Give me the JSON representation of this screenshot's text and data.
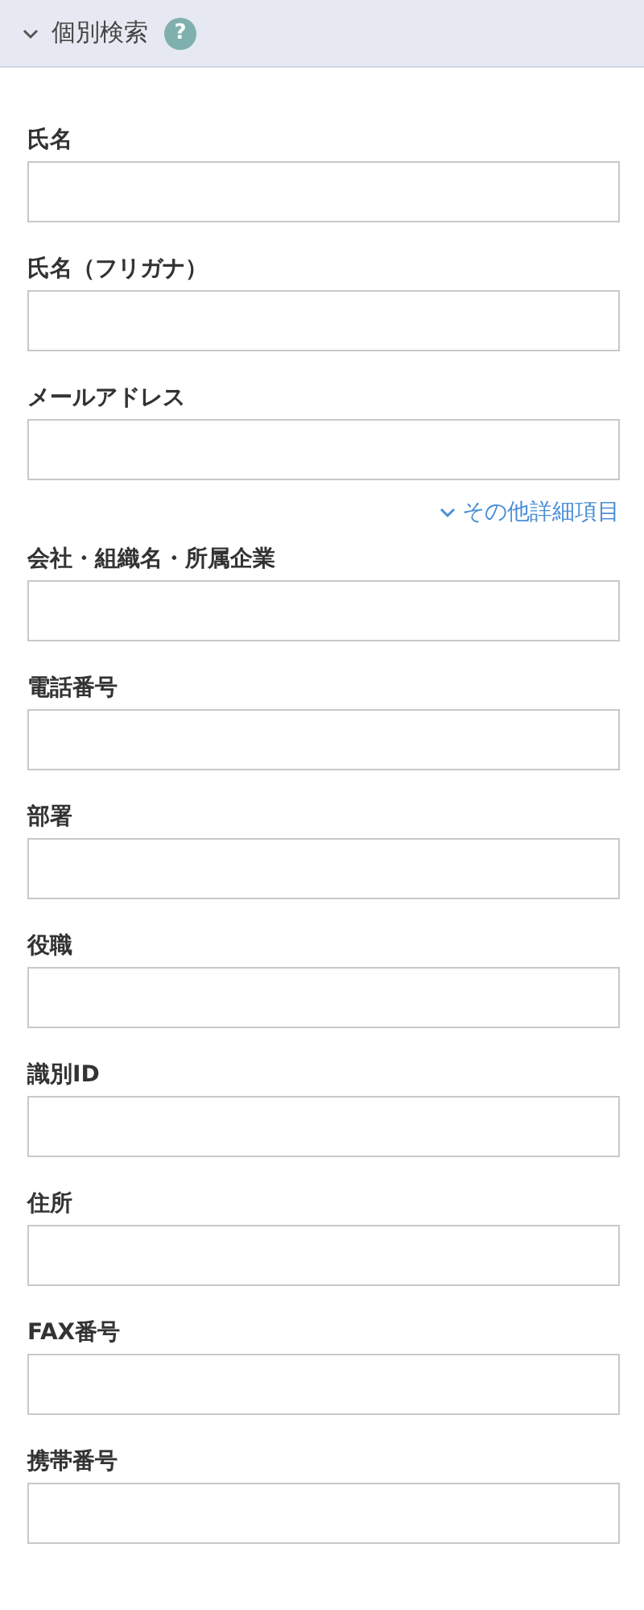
{
  "header": {
    "title": "個別検索",
    "help": "?",
    "expanded": true
  },
  "fields": [
    {
      "label": "氏名"
    },
    {
      "label": "氏名（フリガナ）"
    },
    {
      "label": "メールアドレス"
    }
  ],
  "more_link": {
    "label": "その他詳細項目"
  },
  "more_fields": [
    {
      "label": "会社・組織名・所属企業"
    },
    {
      "label": "電話番号"
    },
    {
      "label": "部署"
    },
    {
      "label": "役職"
    },
    {
      "label": "識別ID"
    },
    {
      "label": "住所"
    },
    {
      "label": "FAX番号"
    },
    {
      "label": "携帯番号"
    }
  ]
}
